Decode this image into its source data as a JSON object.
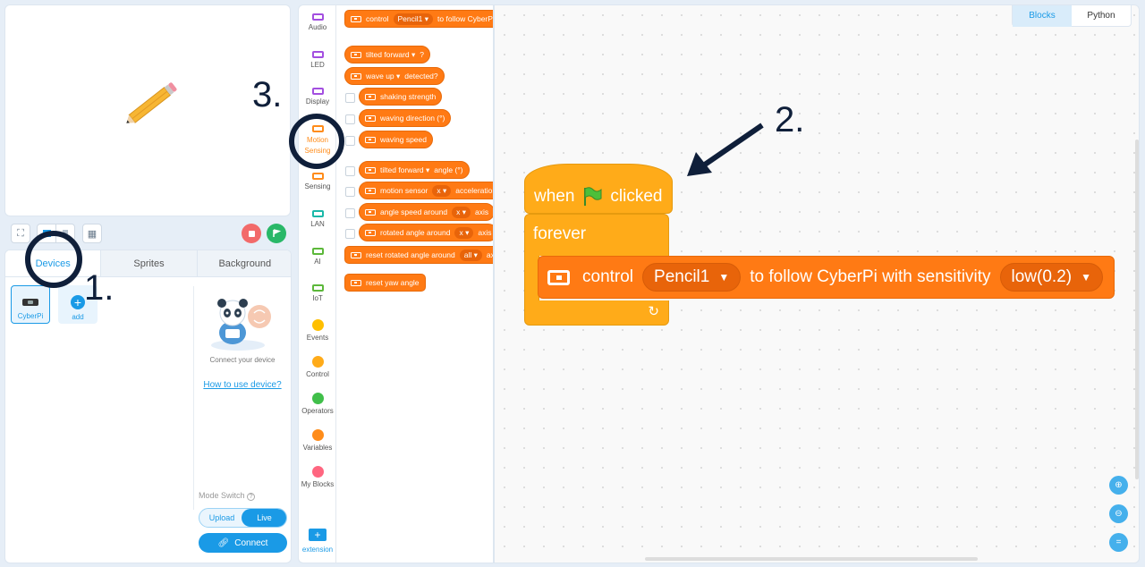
{
  "stage": {
    "sprite": "pencil"
  },
  "stage_controls": {
    "stop_icon": "stop-icon",
    "go_icon": "green-flag-icon"
  },
  "tabs": [
    "Devices",
    "Sprites",
    "Background"
  ],
  "devices": {
    "cyberpi_label": "CyberPi",
    "add_label": "add"
  },
  "device_panel": {
    "connect_text": "Connect your device",
    "howto_link": "How to use device?"
  },
  "mode": {
    "label": "Mode Switch",
    "upload": "Upload",
    "live": "Live",
    "connect": "Connect"
  },
  "categories": [
    {
      "label": "Audio",
      "color": "#a34fe0"
    },
    {
      "label": "LED",
      "color": "#a34fe0"
    },
    {
      "label": "Display",
      "color": "#a34fe0"
    },
    {
      "label": "Motion Sensing",
      "color": "#ff8c1a"
    },
    {
      "label": "Sensing",
      "color": "#ff8c1a"
    },
    {
      "label": "LAN",
      "color": "#1ab8a8"
    },
    {
      "label": "AI",
      "color": "#5cb83a"
    },
    {
      "label": "IoT",
      "color": "#5cb83a"
    },
    {
      "label": "Events",
      "color": "#ffbf00"
    },
    {
      "label": "Control",
      "color": "#ffab19"
    },
    {
      "label": "Operators",
      "color": "#40bf4a"
    },
    {
      "label": "Variables",
      "color": "#ff8c1a"
    },
    {
      "label": "My Blocks",
      "color": "#ff6680"
    }
  ],
  "extension_label": "extension",
  "palette": {
    "b0": {
      "t1": "control",
      "d1": "Pencil1 ▾",
      "t2": "to follow CyberPi"
    },
    "b1": {
      "d1": "tilted forward ▾",
      "t2": "?"
    },
    "b2": {
      "d1": "wave up ▾",
      "t2": "detected?"
    },
    "b3": "shaking strength",
    "b4": "waving direction (°)",
    "b5": "waving speed",
    "b6": {
      "d1": "tilted forward ▾",
      "t2": "angle (°)"
    },
    "b7": {
      "t1": "motion sensor",
      "d1": "x ▾",
      "t2": "acceleration"
    },
    "b8": {
      "t1": "angle speed around",
      "d1": "x ▾",
      "t2": "axis"
    },
    "b9": {
      "t1": "rotated angle around",
      "d1": "x ▾",
      "t2": "axis"
    },
    "b10": {
      "t1": "reset rotated angle around",
      "d1": "all ▾",
      "t2": "axis"
    },
    "b11": "reset yaw angle"
  },
  "lang_tabs": [
    "Blocks",
    "Python"
  ],
  "script": {
    "when": "when",
    "clicked": "clicked",
    "forever": "forever",
    "control": "control",
    "sprite_dropdown": "Pencil1",
    "follow_text": "to follow CyberPi with sensitivity",
    "sensitivity_dropdown": "low(0.2)"
  },
  "zoom": {
    "in_icon": "zoom-in-icon",
    "out_icon": "zoom-out-icon",
    "reset_icon": "zoom-reset-icon"
  },
  "annotations": {
    "n1": "1.",
    "n2": "2.",
    "n3": "3."
  }
}
